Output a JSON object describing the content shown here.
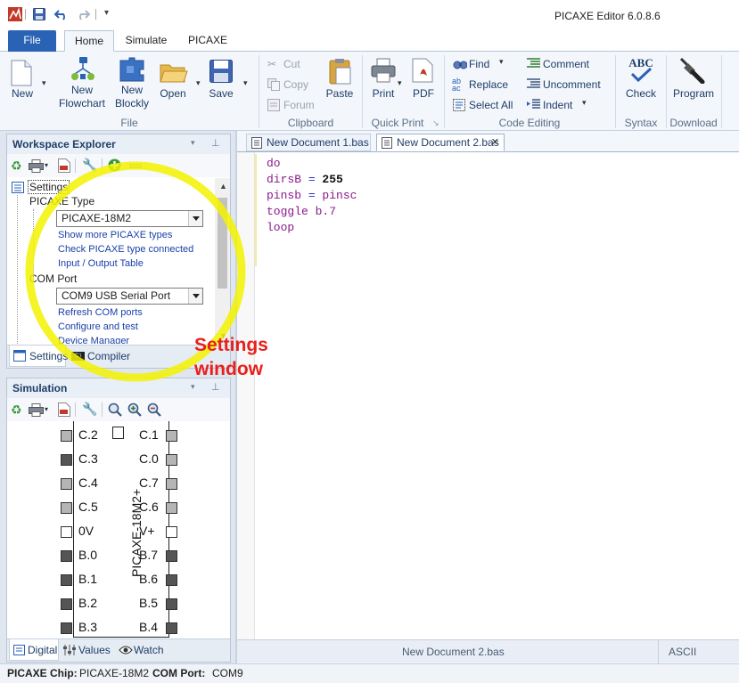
{
  "window": {
    "title": "PICAXE Editor 6.0.8.6"
  },
  "tabs": [
    "File",
    "Home",
    "Simulate",
    "PICAXE"
  ],
  "ribbon": {
    "file_group": {
      "label": "File",
      "new": "New",
      "new_flowchart": [
        "New",
        "Flowchart"
      ],
      "new_blockly": [
        "New",
        "Blockly"
      ],
      "open": "Open",
      "save": "Save"
    },
    "clipboard_group": {
      "label": "Clipboard",
      "cut": "Cut",
      "copy": "Copy",
      "forum": "Forum",
      "paste": "Paste"
    },
    "quickprint_group": {
      "label": "Quick Print",
      "print": "Print",
      "pdf": "PDF"
    },
    "codeediting_group": {
      "label": "Code Editing",
      "find": "Find",
      "replace": "Replace",
      "select_all": "Select All",
      "comment": "Comment",
      "uncomment": "Uncomment",
      "indent": "Indent"
    },
    "syntax_group": {
      "label": "Syntax",
      "check": "Check",
      "check_icon_text": "ABC"
    },
    "download_group": {
      "label": "Download",
      "program": "Program"
    }
  },
  "workspace": {
    "title": "Workspace Explorer",
    "tree_root": "Settings",
    "picaxe_type_label": "PICAXE Type",
    "picaxe_type_value": "PICAXE-18M2",
    "links1": [
      "Show more PICAXE types",
      "Check PICAXE type connected",
      "Input / Output Table"
    ],
    "com_port_label": "COM Port",
    "com_port_value": "COM9 USB Serial Port",
    "links2": [
      "Refresh COM ports",
      "Configure and test",
      "Device Manager"
    ],
    "bottom_tabs": [
      "Settings",
      "Compiler"
    ]
  },
  "annotation": {
    "line1": "Settings",
    "line2": "window",
    "color": "#e8201c",
    "circle_color": "#f3f200"
  },
  "simulation": {
    "title": "Simulation",
    "chip_name": "PICAXE-18M2+",
    "left_pins": [
      "C.2",
      "C.3",
      "C.4",
      "C.5",
      "0V",
      "B.0",
      "B.1",
      "B.2",
      "B.3"
    ],
    "right_pins": [
      "C.1",
      "C.0",
      "C.7",
      "C.6",
      "V+",
      "B.7",
      "B.6",
      "B.5",
      "B.4"
    ],
    "bottom_tabs": [
      "Digital",
      "Values",
      "Watch"
    ]
  },
  "editor": {
    "doc_tabs": [
      "New Document 1.bas",
      "New Document 2.bas"
    ],
    "active_tab_close": "✕",
    "code_lines": [
      [
        {
          "t": "do",
          "c": "#8b1a8b"
        }
      ],
      [
        {
          "t": "dirsB",
          "c": "#8b1a8b"
        },
        {
          "t": " = ",
          "c": "#2b2bd0"
        },
        {
          "t": "255",
          "c": "#111",
          "b": true
        }
      ],
      [
        {
          "t": "pinsb",
          "c": "#8b1a8b"
        },
        {
          "t": " = ",
          "c": "#2b2bd0"
        },
        {
          "t": "pinsc",
          "c": "#8b1a8b"
        }
      ],
      [
        {
          "t": "toggle b.7",
          "c": "#8b1a8b"
        }
      ],
      [
        {
          "t": "loop",
          "c": "#8b1a8b"
        }
      ]
    ]
  },
  "editor_status": {
    "filename": "New Document 2.bas",
    "encoding": "ASCII"
  },
  "statusbar": {
    "chip_label": "PICAXE Chip:",
    "chip_value": "PICAXE-18M2",
    "port_label": "COM Port:",
    "port_value": "COM9"
  }
}
